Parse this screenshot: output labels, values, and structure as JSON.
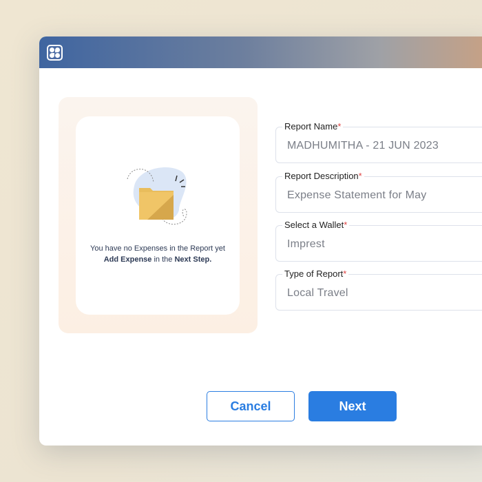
{
  "empty_state": {
    "line1": "You have no Expenses in the Report yet",
    "line2_bold1": "Add Expense",
    "line2_mid": " in the ",
    "line2_bold2": "Next Step."
  },
  "form": {
    "required_mark": "*",
    "fields": [
      {
        "label": "Report Name",
        "value": "MADHUMITHA - 21 JUN 2023"
      },
      {
        "label": "Report Description",
        "value": "Expense Statement for May"
      },
      {
        "label": "Select a Wallet",
        "value": "Imprest"
      },
      {
        "label": "Type of Report",
        "value": "Local Travel"
      }
    ]
  },
  "buttons": {
    "cancel": "Cancel",
    "next": "Next"
  }
}
